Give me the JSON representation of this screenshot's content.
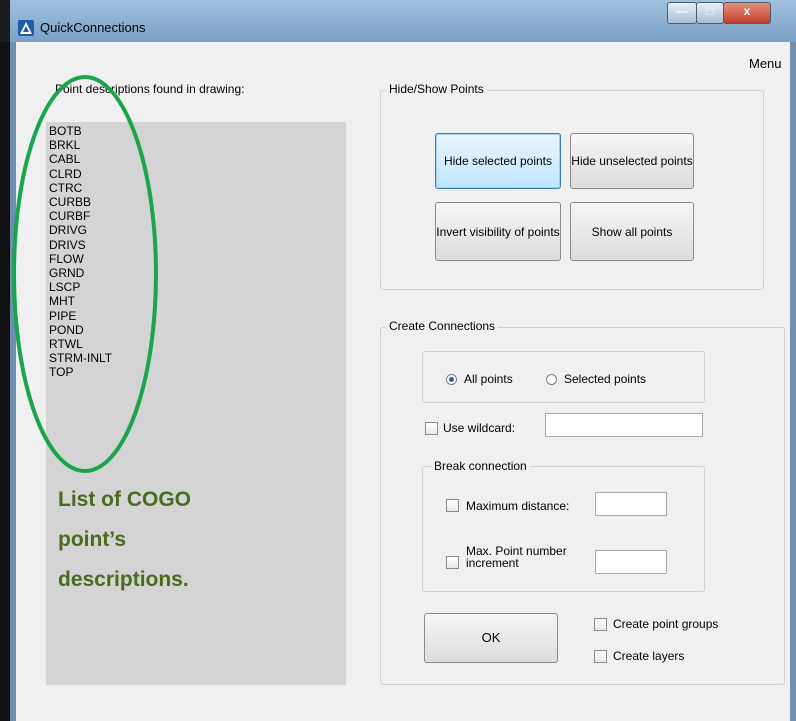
{
  "window": {
    "title": "QuickConnections",
    "min_icon": "minimize-icon",
    "max_icon": "maximize-icon",
    "close_label": "x"
  },
  "menu": "Menu",
  "list": {
    "header": "Point descriptions found in drawing:",
    "items": [
      "BOTB",
      "BRKL",
      "CABL",
      "CLRD",
      "CTRC",
      "CURBB",
      "CURBF",
      "DRIVG",
      "DRIVS",
      "FLOW",
      "GRND",
      "LSCP",
      "MHT",
      "PIPE",
      "POND",
      "RTWL",
      "STRM-INLT",
      "TOP"
    ]
  },
  "annotation": [
    "List of COGO",
    "point’s",
    "descriptions."
  ],
  "hide_show": {
    "legend": "Hide/Show Points",
    "hide_selected": "Hide selected points",
    "hide_unselected": "Hide unselected points",
    "invert_visibility": "Invert visibility of points",
    "show_all": "Show all points"
  },
  "create": {
    "legend": "Create Connections",
    "all_points": "All points",
    "selected_points": "Selected points",
    "points_mode": "All points",
    "use_wildcard": "Use wildcard:",
    "wildcard_value": "",
    "break_legend": "Break connection",
    "max_distance": "Maximum distance:",
    "max_distance_value": "",
    "max_increment": "Max. Point number increment",
    "max_increment_value": "",
    "ok": "OK",
    "point_groups": "Create point groups",
    "layers": "Create layers"
  },
  "colors": {
    "annotation": "#4a6b1d",
    "ellipse": "#1aa54b",
    "focused_button": "#3c7fb1"
  }
}
